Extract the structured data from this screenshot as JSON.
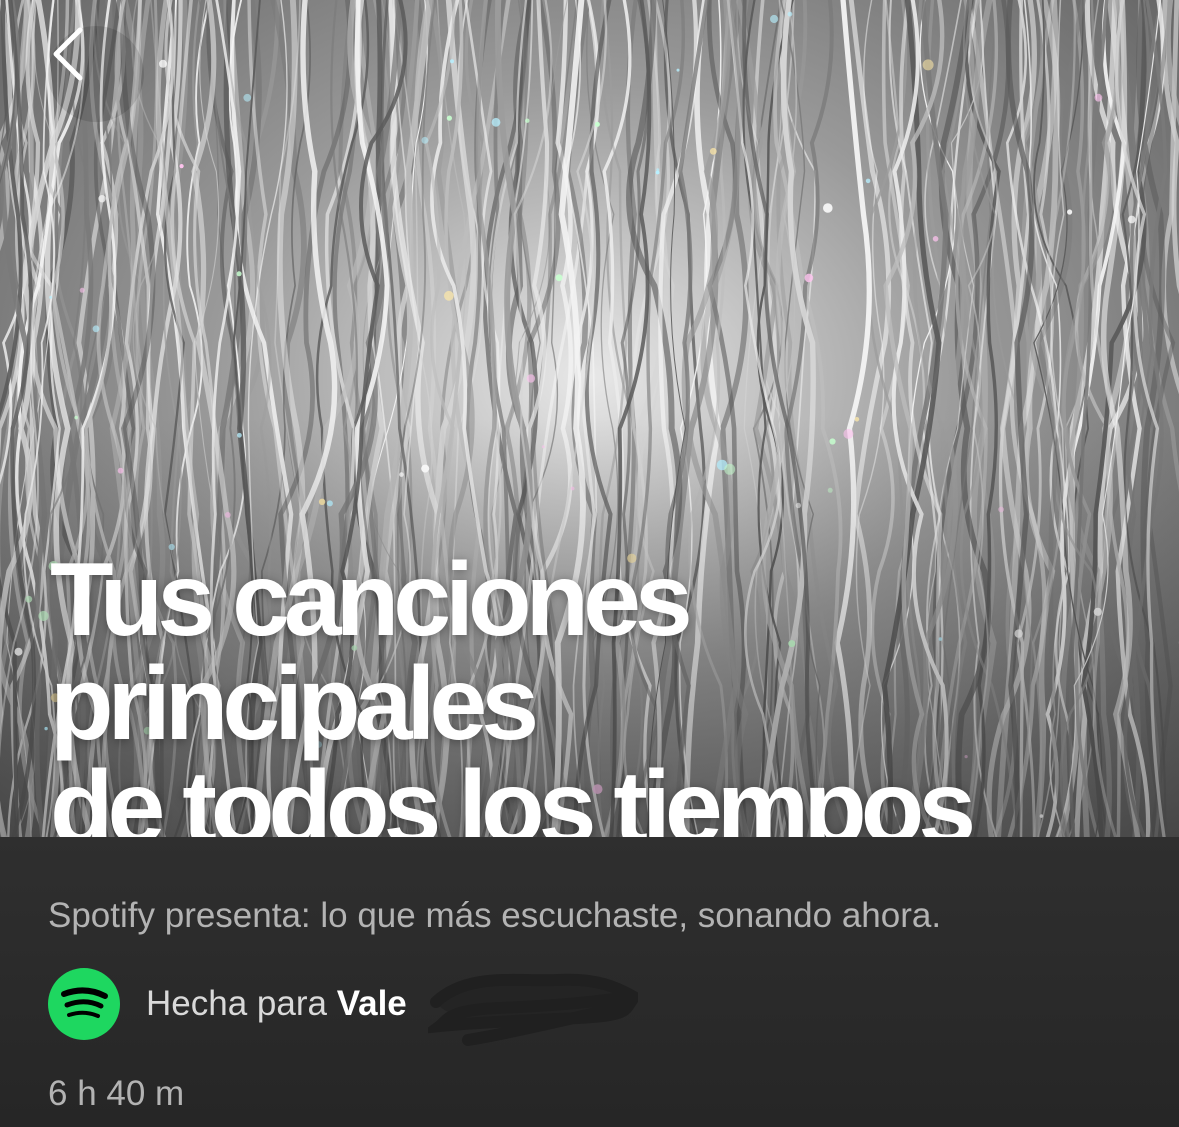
{
  "header": {
    "back_icon": "chevron-left-icon"
  },
  "cover": {
    "image": "silver-holographic-tinsel-curtain",
    "title_line_1": "Tus canciones principales",
    "title_line_2": "de todos los tiempos"
  },
  "playlist": {
    "description": "Spotify presenta: lo que más escuchaste, sonando ahora.",
    "owner_prefix": "Hecha para",
    "owner_name": "Vale",
    "owner_icon": "spotify-logo-icon",
    "duration": "6 h 40 m"
  },
  "colors": {
    "background": "#262626",
    "spotify_green": "#1ed760",
    "secondary_text": "#b3b3b3",
    "primary_text": "#ffffff"
  }
}
